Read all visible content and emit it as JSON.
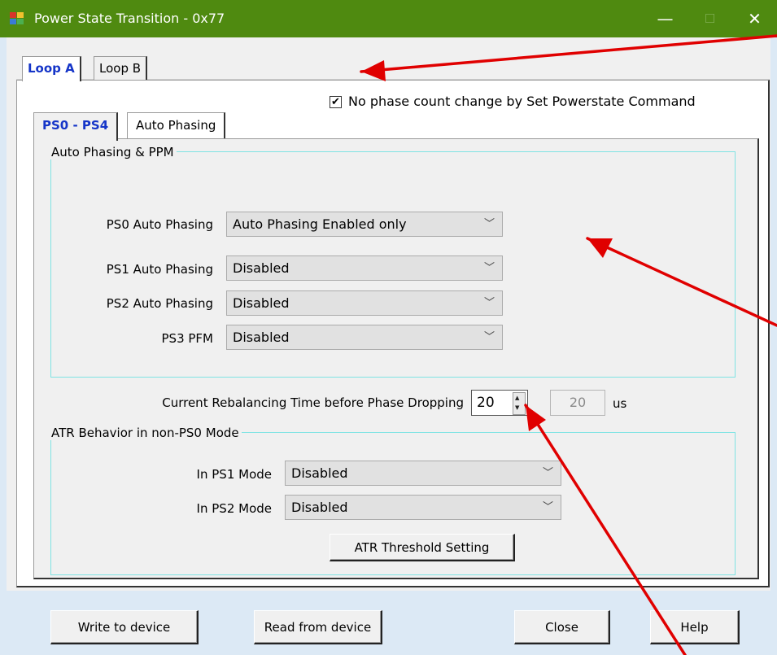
{
  "window": {
    "title": "Power State Transition - 0x77",
    "minimize_glyph": "—",
    "maximize_glyph": "☐",
    "close_glyph": "✕"
  },
  "outer_tabs": [
    {
      "label": "Loop A",
      "active": true
    },
    {
      "label": "Loop B",
      "active": false
    }
  ],
  "no_phase_change": {
    "checked": true,
    "glyph": "✔",
    "label": "No phase count change by Set Powerstate Command"
  },
  "inner_tabs": [
    {
      "label": "PS0 - PS4",
      "active": true
    },
    {
      "label": "Auto Phasing",
      "active": false
    }
  ],
  "auto_phasing_group": {
    "title": "Auto Phasing & PPM",
    "rows": [
      {
        "label": "PS0 Auto Phasing",
        "value": "Auto Phasing Enabled only"
      },
      {
        "label": "PS1 Auto Phasing",
        "value": "Disabled"
      },
      {
        "label": "PS2 Auto Phasing",
        "value": "Disabled"
      },
      {
        "label": "PS3 PFM",
        "value": "Disabled"
      }
    ]
  },
  "rebalancing": {
    "label": "Current Rebalancing Time before Phase Dropping",
    "value": "20",
    "readonly_value": "20",
    "unit": "us"
  },
  "atr_group": {
    "title": "ATR Behavior in non-PS0 Mode",
    "rows": [
      {
        "label": "In PS1 Mode",
        "value": "Disabled"
      },
      {
        "label": "In PS2 Mode",
        "value": "Disabled"
      }
    ],
    "threshold_button": "ATR Threshold Setting"
  },
  "buttons": {
    "write": "Write to device",
    "read": "Read from device",
    "close": "Close",
    "help": "Help"
  },
  "icons": {
    "chevron": "﹀",
    "spin_up": "▲",
    "spin_down": "▼"
  },
  "colors": {
    "titlebar": "#4f8a10",
    "active_tab_text": "#1535c8",
    "group_border": "#7fe3e3",
    "annotation_arrow": "#e00000"
  }
}
